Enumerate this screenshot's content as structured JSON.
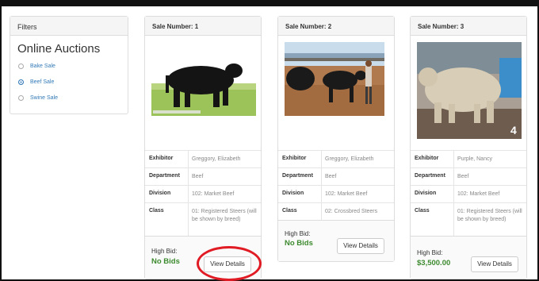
{
  "filters": {
    "header": "Filters",
    "title": "Online Auctions",
    "options": [
      {
        "label": "Bake Sale",
        "selected": false
      },
      {
        "label": "Beef Sale",
        "selected": true
      },
      {
        "label": "Swine Sale",
        "selected": false
      }
    ]
  },
  "cards": [
    {
      "title": "Sale Number: 1",
      "rows": [
        {
          "k": "Exhibitor",
          "v": "Greggory, Elizabeth"
        },
        {
          "k": "Department",
          "v": "Beef"
        },
        {
          "k": "Division",
          "v": "102: Market Beef"
        },
        {
          "k": "Class",
          "v": "01: Registered Steers (will be shown by breed)"
        }
      ],
      "bid_label": "High Bid:",
      "bid_value": "No Bids",
      "button": "View Details"
    },
    {
      "title": "Sale Number: 2",
      "rows": [
        {
          "k": "Exhibitor",
          "v": "Greggory, Elizabeth"
        },
        {
          "k": "Department",
          "v": "Beef"
        },
        {
          "k": "Division",
          "v": "102: Market Beef"
        },
        {
          "k": "Class",
          "v": "02: Crossbred Steers"
        }
      ],
      "bid_label": "High Bid:",
      "bid_value": "No Bids",
      "button": "View Details"
    },
    {
      "title": "Sale Number: 3",
      "photo_badge": "4",
      "rows": [
        {
          "k": "Exhibitor",
          "v": "Purple, Nancy"
        },
        {
          "k": "Department",
          "v": "Beef"
        },
        {
          "k": "Division",
          "v": "102: Market Beef"
        },
        {
          "k": "Class",
          "v": "01: Registered Steers (will be shown by breed)"
        }
      ],
      "bid_label": "High Bid:",
      "bid_value": "$3,500.00",
      "button": "View Details"
    }
  ],
  "colors": {
    "link": "#337ab7",
    "bid": "#3c8a2e",
    "highlight": "#e01b24"
  }
}
